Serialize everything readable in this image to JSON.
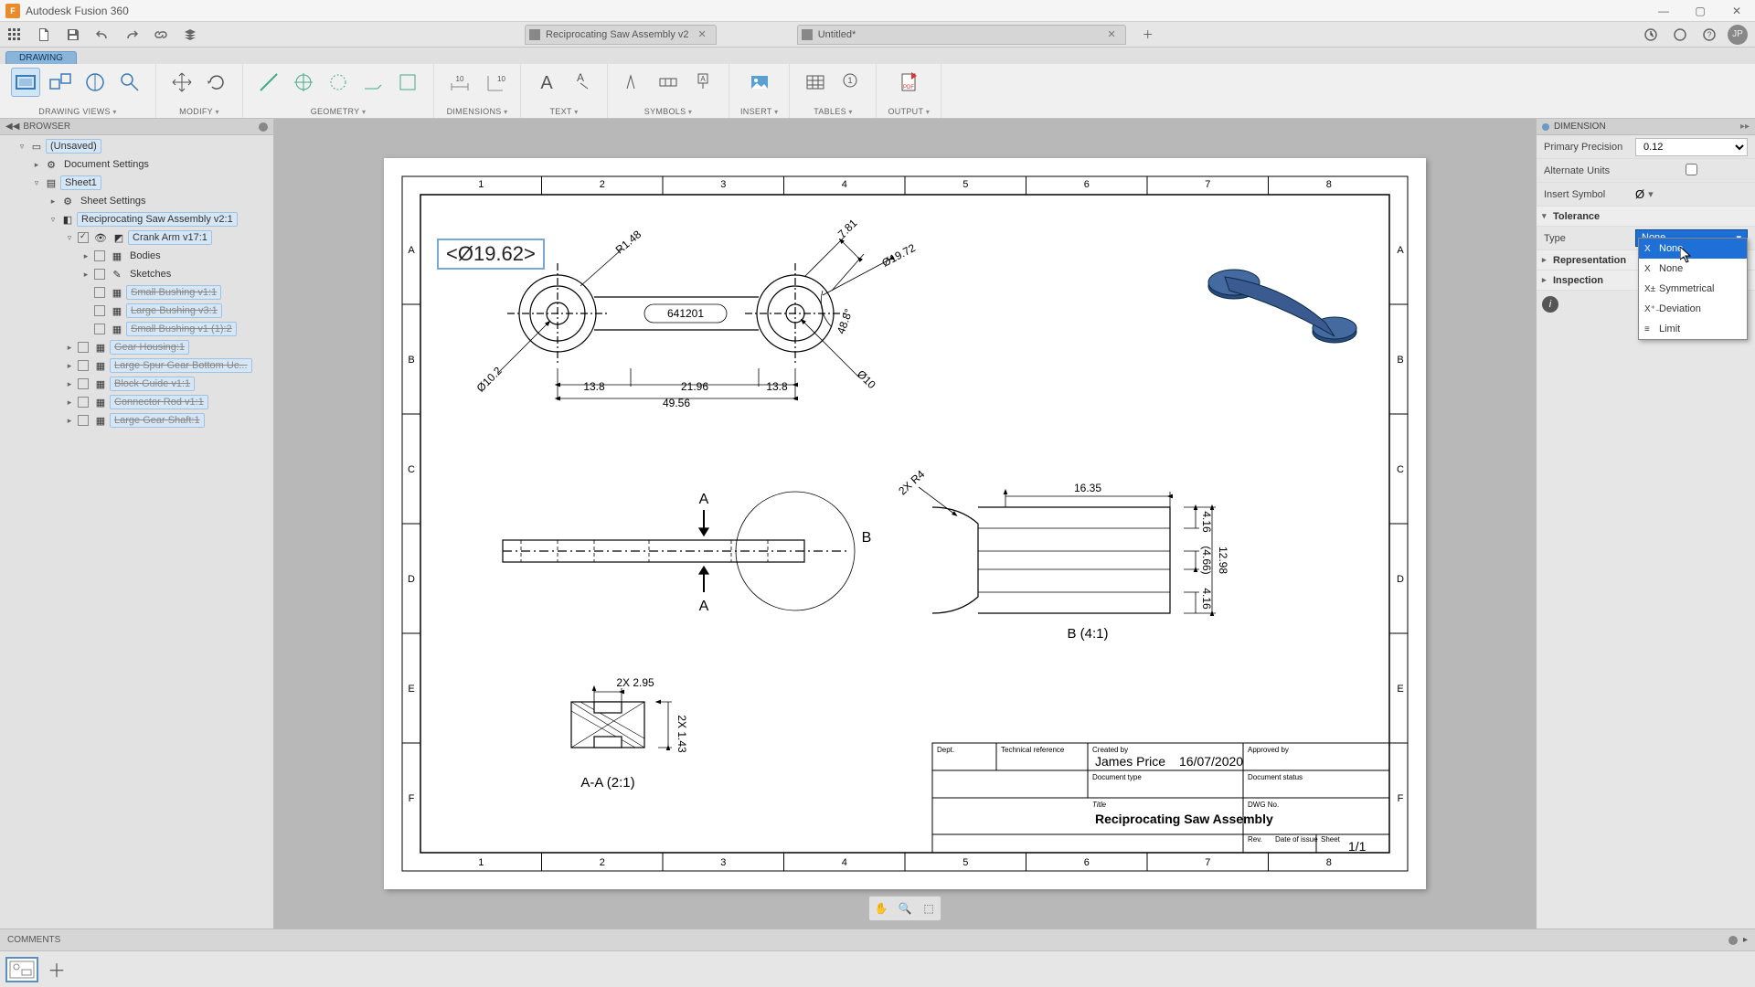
{
  "app": {
    "title": "Autodesk Fusion 360"
  },
  "quickbar": {
    "profile": "JP"
  },
  "doc_tabs": [
    {
      "label": "Reciprocating Saw Assembly v2",
      "dirty": false
    },
    {
      "label": "Untitled*",
      "dirty": true
    }
  ],
  "workspace_tab": "DRAWING",
  "ribbon": [
    {
      "label": "DRAWING VIEWS"
    },
    {
      "label": "MODIFY"
    },
    {
      "label": "GEOMETRY"
    },
    {
      "label": "DIMENSIONS"
    },
    {
      "label": "TEXT"
    },
    {
      "label": "SYMBOLS"
    },
    {
      "label": "INSERT"
    },
    {
      "label": "TABLES"
    },
    {
      "label": "OUTPUT"
    }
  ],
  "browser": {
    "title": "BROWSER",
    "items": {
      "root": "(Unsaved)",
      "docset": "Document Settings",
      "sheet": "Sheet1",
      "sheetset": "Sheet Settings",
      "asm": "Reciprocating Saw Assembly v2:1",
      "crank": "Crank Arm v17:1",
      "bodies": "Bodies",
      "sketches": "Sketches",
      "sb": "Small Bushing v1:1",
      "lb": "Large Bushing v3:1",
      "sb2": "Small Bushing v1 (1):2",
      "gh": "Gear Housing:1",
      "lsg": "Large Spur Gear Bottom Uc...",
      "bg": "Block Guide v1:1",
      "cr": "Connector Rod v1:1",
      "lgs": "Large Gear Shaft:1"
    }
  },
  "canvas": {
    "dim_edit": "<Ø19.62>",
    "ruler_cols": [
      "1",
      "2",
      "3",
      "4",
      "5",
      "6",
      "7",
      "8"
    ],
    "ruler_rows": [
      "A",
      "B",
      "C",
      "D",
      "E",
      "F"
    ],
    "dims": {
      "r148": "R1.48",
      "d7_81": "7.81",
      "d19_72": "Ø19.72",
      "a48_8": "48.8°",
      "d10": "Ø10",
      "d10_2": "Ø10.2",
      "d641201": "641201",
      "d13_8a": "13.8",
      "d21_96": "21.96",
      "d13_8b": "13.8",
      "d49_56": "49.56",
      "sec_a_top": "A",
      "sec_a_bot": "A",
      "detail_b": "B",
      "lbl_aa": "A-A (2:1)",
      "lbl_b": "B (4:1)",
      "d2x295": "2X 2.95",
      "d2x143": "2X 1.43",
      "d2xr4": "2X R4",
      "d16_35": "16.35",
      "d4_16a": "4.16",
      "d4_66": "(4.66)",
      "d4_16b": "4.16",
      "d12_98": "12.98"
    },
    "titleblock": {
      "dept_h": "Dept.",
      "techref_h": "Technical reference",
      "created_h": "Created by",
      "approved_h": "Approved by",
      "doctype_h": "Document type",
      "docstat_h": "Document status",
      "title_h": "Title",
      "dwgno_h": "DWG No.",
      "rev_h": "Rev.",
      "doi_h": "Date of issue",
      "sheet_h": "Sheet",
      "created_by": "James Price",
      "created_date": "16/07/2020",
      "title": "Reciprocating Saw Assembly",
      "sheet": "1/1"
    }
  },
  "props": {
    "title": "DIMENSION",
    "primary_precision_label": "Primary Precision",
    "primary_precision": "0.12",
    "alt_units_label": "Alternate Units",
    "insert_symbol_label": "Insert Symbol",
    "insert_symbol_val": "Ø",
    "tolerance_label": "Tolerance",
    "type_label": "Type",
    "type_val": "None",
    "representation_label": "Representation",
    "inspection_label": "Inspection",
    "dropdown": {
      "selected": "None",
      "opts": [
        "None",
        "None",
        "Symmetrical",
        "Deviation",
        "Limit"
      ]
    }
  },
  "comments": {
    "label": "COMMENTS"
  },
  "viewctrls": {}
}
